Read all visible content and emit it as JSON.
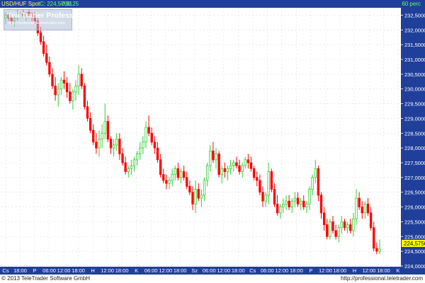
{
  "header": {
    "symbol": "USD/HUF Spot",
    "close_label": "C: 224,5750",
    "change": "-0,9125",
    "period": "60 perc"
  },
  "watermark": {
    "logo": "TeleTrader Professional",
    "url": "http://professional.teletrader.com"
  },
  "footer": {
    "copyright": "© 2013 TeleTrader Software GmbH",
    "url": "http://professional.teletrader.com"
  },
  "colors": {
    "up": "#33cc33",
    "down": "#ff0000",
    "header_bg": "#1f3f9a",
    "axis_bg": "#1f3f9a",
    "last_price_bg": "#ffff00"
  },
  "chart_data": {
    "type": "candlestick",
    "last_price_label": "224,5750",
    "y_ticks": [
      "224,0000",
      "224,5000",
      "225,0000",
      "225,5000",
      "226,0000",
      "226,5000",
      "227,0000",
      "227,5000",
      "228,0000",
      "228,5000",
      "229,0000",
      "229,5000",
      "230,0000",
      "230,5000",
      "231,0000",
      "231,5000",
      "232,0000",
      "232,5000"
    ],
    "x_ticks": [
      "Cs",
      "18:00",
      "P",
      "06:00",
      "12:00",
      "18:00",
      "H",
      "12:00",
      "18:00",
      "K",
      "06:00",
      "12:00",
      "18:00",
      "Sz",
      "06:00",
      "12:00",
      "18:00",
      "Cs",
      "06:00",
      "12:00",
      "18:00",
      "P",
      "12:00",
      "18:00",
      "H",
      "12:00",
      "18:00",
      "K"
    ],
    "ylim": [
      224,
      232.75
    ],
    "grid": true,
    "candles": [
      [
        232.4,
        232.6,
        232.2,
        232.5
      ],
      [
        232.5,
        232.6,
        232.3,
        232.4
      ],
      [
        232.4,
        232.5,
        232.2,
        232.3
      ],
      [
        232.3,
        232.5,
        232.1,
        232.4
      ],
      [
        232.4,
        232.7,
        232.3,
        232.5
      ],
      [
        232.5,
        232.6,
        232.4,
        232.55
      ],
      [
        232.55,
        232.7,
        232.4,
        232.5
      ],
      [
        232.5,
        232.6,
        232.3,
        232.6
      ],
      [
        232.6,
        232.7,
        232.4,
        232.5
      ],
      [
        232.5,
        232.6,
        232.3,
        232.45
      ],
      [
        232.45,
        232.6,
        232.2,
        232.3
      ],
      [
        232.3,
        232.4,
        231.8,
        231.9
      ],
      [
        231.9,
        232.1,
        231.5,
        231.6
      ],
      [
        231.6,
        231.8,
        231.1,
        231.2
      ],
      [
        231.2,
        231.5,
        230.8,
        230.9
      ],
      [
        230.9,
        231.1,
        230.4,
        230.5
      ],
      [
        230.5,
        230.7,
        230.0,
        230.1
      ],
      [
        230.1,
        230.4,
        229.6,
        229.8
      ],
      [
        229.8,
        230.2,
        229.4,
        230.0
      ],
      [
        230.0,
        230.4,
        229.8,
        230.3
      ],
      [
        230.3,
        230.6,
        230.0,
        230.2
      ],
      [
        230.2,
        230.4,
        229.7,
        229.9
      ],
      [
        229.9,
        230.2,
        229.5,
        229.6
      ],
      [
        229.6,
        230.0,
        229.3,
        229.9
      ],
      [
        229.9,
        230.3,
        229.6,
        230.1
      ],
      [
        230.1,
        230.8,
        229.8,
        230.5
      ],
      [
        230.5,
        230.7,
        230.0,
        230.1
      ],
      [
        230.1,
        230.2,
        229.3,
        229.4
      ],
      [
        229.4,
        229.6,
        228.9,
        229.0
      ],
      [
        229.0,
        229.2,
        228.5,
        228.6
      ],
      [
        228.6,
        228.8,
        228.1,
        228.2
      ],
      [
        228.2,
        228.5,
        227.8,
        228.0
      ],
      [
        228.0,
        228.6,
        227.7,
        228.3
      ],
      [
        228.3,
        228.8,
        228.0,
        228.5
      ],
      [
        228.5,
        229.5,
        228.3,
        228.9
      ],
      [
        228.9,
        229.1,
        228.2,
        228.3
      ],
      [
        228.3,
        228.4,
        227.8,
        228.0
      ],
      [
        228.0,
        228.3,
        227.7,
        228.1
      ],
      [
        228.1,
        228.5,
        227.9,
        228.3
      ],
      [
        228.3,
        228.5,
        227.6,
        227.8
      ],
      [
        227.8,
        228.0,
        227.4,
        227.5
      ],
      [
        227.5,
        227.7,
        227.1,
        227.2
      ],
      [
        227.2,
        227.4,
        227.0,
        227.3
      ],
      [
        227.3,
        227.6,
        227.1,
        227.4
      ],
      [
        227.4,
        227.7,
        227.2,
        227.6
      ],
      [
        227.6,
        227.9,
        227.4,
        227.8
      ],
      [
        227.8,
        228.2,
        227.6,
        228.0
      ],
      [
        228.0,
        228.4,
        227.8,
        228.2
      ],
      [
        228.2,
        228.9,
        228.0,
        228.7
      ],
      [
        228.7,
        229.1,
        228.4,
        228.5
      ],
      [
        228.5,
        228.7,
        228.1,
        228.2
      ],
      [
        228.2,
        228.4,
        227.8,
        228.0
      ],
      [
        228.0,
        228.2,
        227.5,
        227.6
      ],
      [
        227.6,
        227.8,
        227.0,
        227.1
      ],
      [
        227.1,
        227.3,
        226.8,
        226.9
      ],
      [
        226.9,
        227.1,
        226.6,
        226.8
      ],
      [
        226.8,
        227.0,
        226.6,
        226.9
      ],
      [
        226.9,
        227.3,
        226.7,
        227.1
      ],
      [
        227.1,
        227.4,
        226.9,
        227.3
      ],
      [
        227.3,
        227.5,
        226.9,
        227.0
      ],
      [
        227.0,
        227.3,
        226.8,
        227.2
      ],
      [
        227.2,
        227.4,
        226.9,
        227.0
      ],
      [
        227.0,
        227.2,
        226.6,
        226.7
      ],
      [
        226.7,
        226.9,
        226.4,
        226.5
      ],
      [
        226.5,
        226.7,
        225.9,
        226.1
      ],
      [
        226.1,
        226.9,
        225.8,
        226.6
      ],
      [
        226.6,
        226.8,
        226.2,
        226.3
      ],
      [
        226.3,
        226.6,
        226.0,
        226.4
      ],
      [
        226.4,
        227.0,
        226.2,
        226.9
      ],
      [
        226.9,
        227.5,
        226.7,
        227.4
      ],
      [
        227.4,
        228.1,
        227.2,
        227.9
      ],
      [
        227.9,
        228.2,
        227.5,
        227.6
      ],
      [
        227.6,
        228.0,
        227.3,
        227.8
      ],
      [
        227.8,
        227.9,
        227.0,
        227.1
      ],
      [
        227.1,
        227.4,
        226.8,
        227.3
      ],
      [
        227.3,
        227.5,
        227.0,
        227.2
      ],
      [
        227.2,
        227.4,
        226.9,
        227.3
      ],
      [
        227.3,
        227.6,
        227.1,
        227.4
      ],
      [
        227.4,
        227.6,
        227.2,
        227.5
      ],
      [
        227.5,
        227.7,
        227.3,
        227.4
      ],
      [
        227.4,
        227.6,
        227.1,
        227.2
      ],
      [
        227.2,
        227.5,
        227.0,
        227.4
      ],
      [
        227.4,
        227.7,
        227.3,
        227.6
      ],
      [
        227.6,
        227.8,
        227.3,
        227.5
      ],
      [
        227.5,
        227.7,
        227.2,
        227.3
      ],
      [
        227.3,
        227.4,
        226.9,
        227.0
      ],
      [
        227.0,
        227.2,
        226.7,
        226.9
      ],
      [
        226.9,
        227.1,
        226.4,
        226.5
      ],
      [
        226.5,
        226.7,
        226.0,
        226.2
      ],
      [
        226.2,
        226.5,
        226.0,
        226.4
      ],
      [
        226.4,
        227.5,
        226.1,
        227.2
      ],
      [
        227.2,
        227.3,
        226.5,
        226.6
      ],
      [
        226.6,
        226.8,
        226.0,
        226.1
      ],
      [
        226.1,
        226.4,
        225.7,
        225.8
      ],
      [
        225.8,
        226.1,
        225.6,
        226.0
      ],
      [
        226.0,
        226.3,
        225.8,
        226.1
      ],
      [
        226.1,
        226.4,
        225.9,
        226.2
      ],
      [
        226.2,
        226.4,
        225.9,
        226.0
      ],
      [
        226.0,
        226.3,
        225.8,
        226.2
      ],
      [
        226.2,
        226.5,
        226.0,
        226.3
      ],
      [
        226.3,
        226.5,
        226.0,
        226.1
      ],
      [
        226.1,
        226.3,
        225.9,
        226.2
      ],
      [
        226.2,
        226.4,
        225.9,
        226.0
      ],
      [
        226.0,
        226.2,
        225.8,
        226.1
      ],
      [
        226.1,
        226.7,
        225.9,
        226.6
      ],
      [
        226.6,
        227.1,
        226.4,
        227.0
      ],
      [
        227.0,
        227.6,
        226.8,
        227.3
      ],
      [
        227.3,
        227.4,
        226.2,
        226.4
      ],
      [
        226.4,
        226.5,
        225.6,
        225.8
      ],
      [
        225.8,
        226.0,
        225.2,
        225.4
      ],
      [
        225.4,
        225.6,
        224.9,
        225.0
      ],
      [
        225.0,
        225.6,
        224.9,
        225.5
      ],
      [
        225.5,
        225.7,
        225.1,
        225.2
      ],
      [
        225.2,
        225.4,
        224.9,
        225.0
      ],
      [
        225.0,
        225.4,
        224.8,
        225.3
      ],
      [
        225.3,
        225.7,
        225.1,
        225.5
      ],
      [
        225.5,
        225.6,
        225.2,
        225.3
      ],
      [
        225.3,
        225.5,
        225.1,
        225.4
      ],
      [
        225.4,
        225.6,
        225.1,
        225.2
      ],
      [
        225.2,
        225.8,
        225.0,
        225.6
      ],
      [
        225.6,
        226.6,
        225.4,
        226.3
      ],
      [
        226.3,
        226.5,
        225.9,
        226.0
      ],
      [
        226.0,
        226.2,
        225.6,
        225.8
      ],
      [
        225.8,
        226.2,
        225.6,
        226.1
      ],
      [
        226.1,
        226.3,
        225.7,
        225.8
      ],
      [
        225.8,
        226.0,
        225.2,
        225.3
      ],
      [
        225.3,
        225.5,
        224.5,
        224.6
      ],
      [
        224.6,
        224.8,
        224.4,
        224.5
      ],
      [
        224.5,
        224.9,
        224.4,
        224.575
      ]
    ]
  }
}
